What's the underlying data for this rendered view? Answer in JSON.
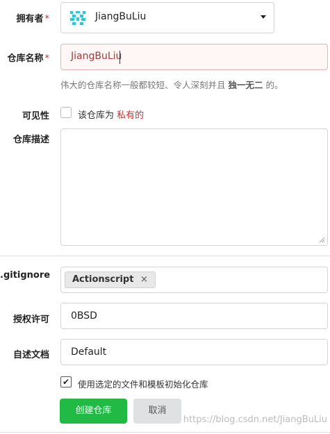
{
  "owner": {
    "label": "拥有者",
    "required_mark": "*",
    "value": "JiangBuLiu"
  },
  "repo_name": {
    "label": "仓库名称",
    "required_mark": "*",
    "value": "JiangBuLiu",
    "hint_prefix": "伟大的仓库名称一般都较短、令人深刻并且 ",
    "hint_emphasis": "独一无二",
    "hint_suffix": " 的。"
  },
  "visibility": {
    "label": "可见性",
    "text_prefix": "该仓库为 ",
    "text_highlight": "私有的",
    "checked": false
  },
  "description": {
    "label": "仓库描述",
    "value": ""
  },
  "gitignore": {
    "label": ".gitignore",
    "tag": "Actionscript",
    "remove_glyph": "×"
  },
  "license": {
    "label": "授权许可",
    "value": "0BSD"
  },
  "readme": {
    "label": "自述文档",
    "value": "Default"
  },
  "auto_init": {
    "label": "使用选定的文件和模板初始化仓库",
    "checked": true,
    "check_glyph": "✔"
  },
  "buttons": {
    "create": "创建仓库",
    "cancel": "取消"
  },
  "watermark": "https://blog.csdn.net/JiangBuLiu",
  "colors": {
    "required": "#db2828",
    "error_bg": "#fff6f6",
    "error_border": "#e0b4b4",
    "primary": "#21ba45",
    "private_text": "#db2828"
  }
}
